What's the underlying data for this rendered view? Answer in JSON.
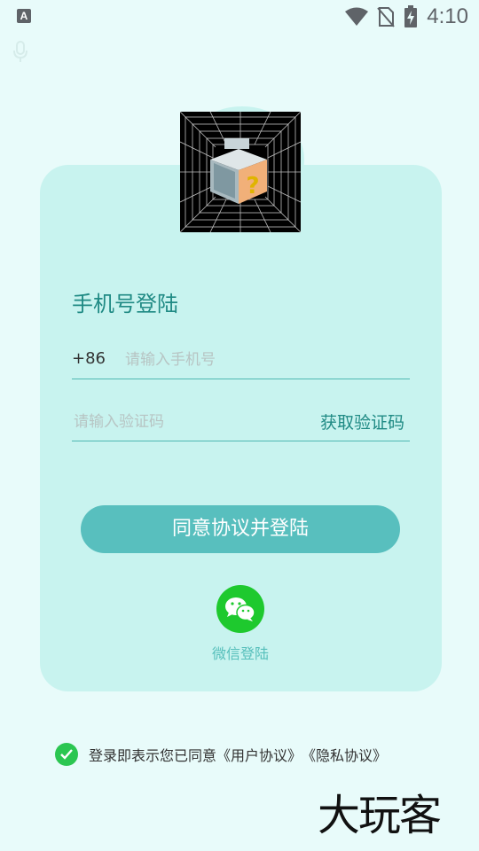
{
  "status_bar": {
    "notification_icon_letter": "A",
    "time": "4:10",
    "icons": [
      "wifi-icon",
      "no-sim-icon",
      "battery-charging-icon"
    ]
  },
  "login": {
    "title": "手机号登陆",
    "country_code": "+86",
    "phone_placeholder": "请输入手机号",
    "phone_value": "",
    "code_placeholder": "请输入验证码",
    "code_value": "",
    "get_code_label": "获取验证码",
    "submit_label": "同意协议并登陆",
    "wechat_label": "微信登陆"
  },
  "agreement": {
    "prefix": "登录即表示您已同意",
    "user_agreement": "《用户协议》",
    "privacy_agreement": "《隐私协议》",
    "checked": true
  },
  "watermark": "大玩客",
  "colors": {
    "background": "#e8fbfa",
    "card": "#c8f3ef",
    "accent": "#1f8a84",
    "button": "#58bfbe",
    "wechat": "#1ec92e",
    "check": "#2bc651"
  }
}
